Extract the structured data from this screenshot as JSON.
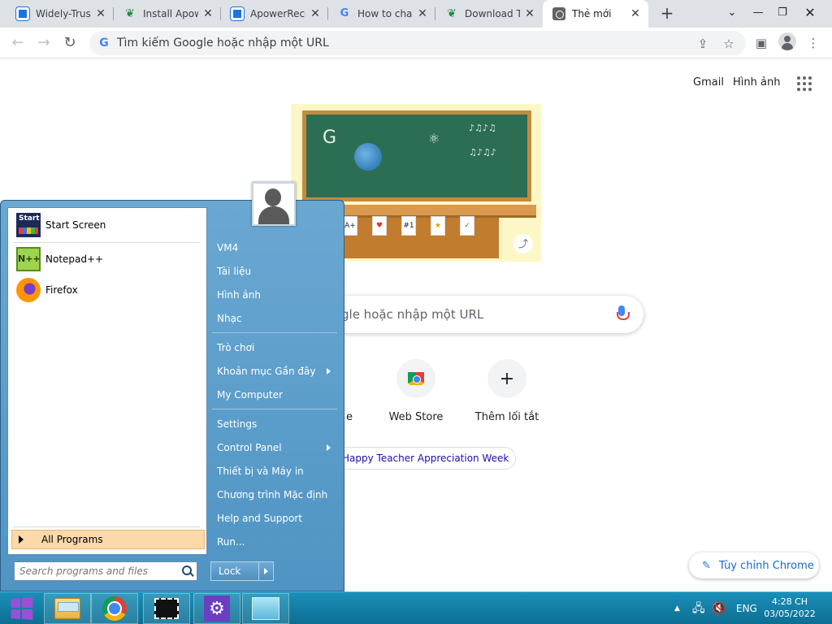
{
  "browser": {
    "tabs": [
      {
        "title": "Widely-Trust",
        "icon": "apowersoft-icon"
      },
      {
        "title": "Install Apow",
        "icon": "leaf-icon"
      },
      {
        "title": "ApowerReco",
        "icon": "apowersoft-icon"
      },
      {
        "title": "How to chan",
        "icon": "google-icon"
      },
      {
        "title": "Download T",
        "icon": "leaf-icon"
      },
      {
        "title": "Thẻ mới",
        "icon": "chrome-icon"
      }
    ],
    "address_placeholder": "Tìm kiếm Google hoặc nhập một URL"
  },
  "ntp": {
    "gmail": "Gmail",
    "images": "Hình ảnh",
    "search_placeholder": "Tìm kiếm Google hoặc nhập một URL",
    "search_visible_fragment": "gle hoặc nhập một URL",
    "shortcuts": [
      {
        "label": "YouTube",
        "visible_label": "e"
      },
      {
        "label": "Web Store"
      },
      {
        "label": "Thêm lối tắt"
      }
    ],
    "doodle_chip": "Happy Teacher Appreciation Week",
    "doodle_cards": [
      "A+",
      "♥",
      "#1",
      "★",
      "✓"
    ],
    "customize": "Tùy chỉnh Chrome"
  },
  "start_menu": {
    "programs": [
      {
        "label": "Start Screen",
        "icon_text": "Start"
      },
      {
        "label": "Notepad++",
        "icon_text": "N++"
      },
      {
        "label": "Firefox"
      }
    ],
    "all_programs": "All Programs",
    "search_placeholder": "Search programs and files",
    "right_items": [
      {
        "label": "VM4"
      },
      {
        "label": "Tài liệu"
      },
      {
        "label": "Hình ảnh"
      },
      {
        "label": "Nhạc"
      },
      {
        "label": "Trò chơi"
      },
      {
        "label": "Khoản mục Gần đây",
        "submenu": true
      },
      {
        "label": "My Computer"
      },
      {
        "label": "Settings"
      },
      {
        "label": "Control Panel",
        "submenu": true
      },
      {
        "label": "Thiết bị và Máy in"
      },
      {
        "label": "Chương trình Mặc định"
      },
      {
        "label": "Help and Support"
      },
      {
        "label": "Run..."
      }
    ],
    "lock": "Lock"
  },
  "taskbar": {
    "language": "ENG",
    "time": "4:28 CH",
    "date": "03/05/2022",
    "tray_arrow": "▲"
  },
  "colors": {
    "start_menu_blue": "#4f94c4",
    "taskbar_blue": "#0d6e93",
    "all_programs_highlight": "#fbd9a9",
    "chrome_link_blue": "#1967d2"
  }
}
